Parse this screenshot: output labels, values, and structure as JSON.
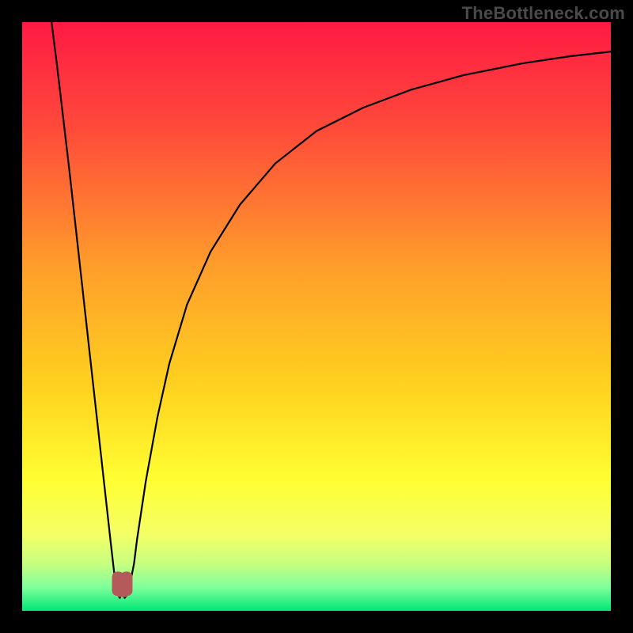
{
  "watermark": "TheBottleneck.com",
  "chart_data": {
    "type": "line",
    "title": "",
    "xlabel": "",
    "ylabel": "",
    "xlim": [
      0,
      100
    ],
    "ylim": [
      0,
      100
    ],
    "grid": false,
    "legend": false,
    "background_gradient": {
      "stops": [
        {
          "offset": 0.0,
          "color": "#ff1a44"
        },
        {
          "offset": 0.18,
          "color": "#ff4a3a"
        },
        {
          "offset": 0.42,
          "color": "#ff9f2a"
        },
        {
          "offset": 0.62,
          "color": "#ffd21f"
        },
        {
          "offset": 0.78,
          "color": "#ffff33"
        },
        {
          "offset": 0.87,
          "color": "#f4ff66"
        },
        {
          "offset": 0.92,
          "color": "#c7ff80"
        },
        {
          "offset": 0.96,
          "color": "#7fff9a"
        },
        {
          "offset": 1.0,
          "color": "#00e676"
        }
      ]
    },
    "series": [
      {
        "name": "left-branch",
        "x": [
          5.0,
          6.0,
          7.0,
          8.0,
          9.0,
          10.0,
          11.0,
          12.0,
          13.0,
          14.0,
          15.0,
          15.8
        ],
        "y": [
          100,
          92.0,
          83.5,
          75.0,
          66.0,
          57.0,
          48.0,
          39.0,
          30.0,
          21.0,
          12.0,
          5.0
        ]
      },
      {
        "name": "notch-bottom",
        "x": [
          15.8,
          16.2,
          16.6,
          17.0,
          17.4,
          17.9,
          18.4,
          19.0,
          19.5
        ],
        "y": [
          5.0,
          2.8,
          2.2,
          3.6,
          2.2,
          2.8,
          5.0,
          8.0,
          12.0
        ]
      },
      {
        "name": "right-branch",
        "x": [
          19.5,
          21.0,
          23.0,
          25.0,
          28.0,
          32.0,
          37.0,
          43.0,
          50.0,
          58.0,
          66.0,
          75.0,
          85.0,
          93.0,
          100.0
        ],
        "y": [
          12.0,
          22.0,
          33.0,
          42.0,
          52.0,
          61.0,
          69.0,
          76.0,
          81.5,
          85.5,
          88.5,
          91.0,
          93.0,
          94.2,
          95.0
        ]
      }
    ],
    "marker": {
      "name": "notch-highlight",
      "shape": "double-lobe",
      "color": "#b45a5a",
      "cx": 17.0,
      "cy": 3.0,
      "width_x": 3.2,
      "height_y": 4.0
    }
  }
}
